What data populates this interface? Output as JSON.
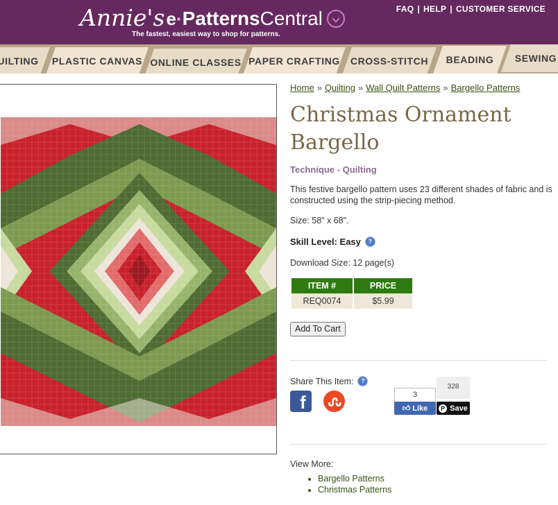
{
  "header": {
    "logo": {
      "annies": "Annie's",
      "e": "e",
      "dot": "·",
      "patterns": "Patterns",
      "central": "Central"
    },
    "tagline": "The fastest, easiest way to shop for patterns.",
    "links": [
      "FAQ",
      "HELP",
      "CUSTOMER SERVICE"
    ],
    "link_separator": "|",
    "background": "#66295f"
  },
  "nav": {
    "tabs": [
      "UILTING",
      "PLASTIC CANVAS",
      "ONLINE CLASSES",
      "PAPER CRAFTING",
      "CROSS-STITCH",
      "BEADING",
      "SEWING"
    ]
  },
  "product_image": {
    "icon": "quilt-image",
    "colors": [
      "#c8212b",
      "#4e6b32",
      "#b9cf8c",
      "#e9e2d6"
    ]
  },
  "breadcrumb": {
    "items": [
      "Home",
      "Quilting",
      "Wall Quilt Patterns",
      "Bargello Patterns"
    ],
    "separator": "»"
  },
  "product": {
    "title": "Christmas Ornament Bargello",
    "technique": "Technique - Quilting",
    "description": "This festive bargello pattern uses 23 different shades of fabric and is constructed using the strip-piecing method.",
    "size": "Size: 58\" x 68\".",
    "skill_level": "Skill Level: Easy",
    "download_size": "Download Size: 12 page(s)",
    "table": {
      "headers": [
        "ITEM #",
        "PRICE"
      ],
      "rows": [
        [
          "REQ0074",
          "$5.99"
        ]
      ]
    },
    "add_to_cart": "Add To Cart"
  },
  "share": {
    "label": "Share This Item:",
    "fb_count": "3",
    "fb_like": "Like",
    "pin_count": "328",
    "pin_save": "Save"
  },
  "view_more": {
    "label": "View More:",
    "items": [
      "Bargello Patterns",
      "Christmas Patterns"
    ]
  }
}
